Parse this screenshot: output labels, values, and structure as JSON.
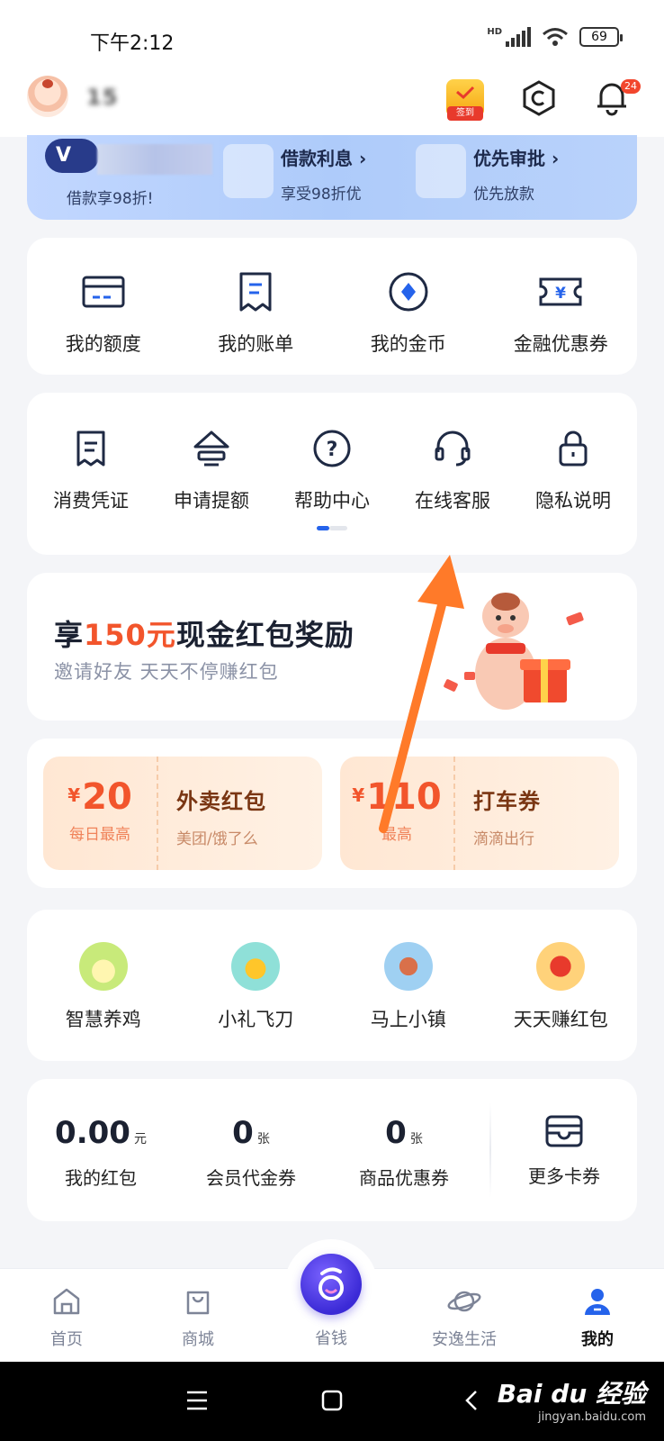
{
  "status_bar": {
    "time": "下午2:12",
    "battery": "69",
    "network_label": "HD"
  },
  "header": {
    "username": "15",
    "checkin_label": "签到",
    "notification_count": "24"
  },
  "banner": {
    "vip_letter": "V",
    "vip_subtitle": "借款享98折!",
    "benefits": [
      {
        "title": "借款利息 ›",
        "subtitle": "享受98折优"
      },
      {
        "title": "优先审批 ›",
        "subtitle": "优先放款"
      }
    ]
  },
  "quick_menu": [
    {
      "label": "我的额度",
      "icon": "credit-card-icon"
    },
    {
      "label": "我的账单",
      "icon": "bill-icon"
    },
    {
      "label": "我的金币",
      "icon": "coin-icon"
    },
    {
      "label": "金融优惠券",
      "icon": "yuan-ticket-icon"
    }
  ],
  "service_menu": [
    {
      "label": "消费凭证",
      "icon": "receipt-icon"
    },
    {
      "label": "申请提额",
      "icon": "raise-limit-icon"
    },
    {
      "label": "帮助中心",
      "icon": "help-icon"
    },
    {
      "label": "在线客服",
      "icon": "headset-icon"
    },
    {
      "label": "隐私说明",
      "icon": "lock-icon"
    }
  ],
  "promo": {
    "title_pre": "享",
    "title_amount": "150元",
    "title_post": "现金红包奖励",
    "subtitle": "邀请好友 天天不停赚红包"
  },
  "coupons": [
    {
      "currency": "¥",
      "amount": "20",
      "caption": "每日最高",
      "name": "外卖红包",
      "desc": "美团/饿了么"
    },
    {
      "currency": "¥",
      "amount": "110",
      "caption": "最高",
      "name": "打车券",
      "desc": "滴滴出行"
    }
  ],
  "games": [
    {
      "label": "智慧养鸡",
      "icon": "chick-icon",
      "color": "#c8ea7a"
    },
    {
      "label": "小礼飞刀",
      "icon": "knife-icon",
      "color": "#8fe0d8"
    },
    {
      "label": "马上小镇",
      "icon": "windmill-icon",
      "color": "#9fd0f2"
    },
    {
      "label": "天天赚红包",
      "icon": "red-packet-icon",
      "color": "#ffd27a"
    }
  ],
  "wallet": [
    {
      "value": "0.00",
      "unit": "元",
      "label": "我的红包"
    },
    {
      "value": "0",
      "unit": "张",
      "label": "会员代金券"
    },
    {
      "value": "0",
      "unit": "张",
      "label": "商品优惠券"
    }
  ],
  "more_cards": {
    "label": "更多卡券",
    "icon": "card-wallet-icon"
  },
  "tabbar": {
    "tabs": [
      {
        "label": "首页",
        "icon": "home-icon"
      },
      {
        "label": "商城",
        "icon": "shopping-bag-icon"
      },
      {
        "label": "省钱",
        "icon": "save-money-icon"
      },
      {
        "label": "安逸生活",
        "icon": "planet-icon"
      },
      {
        "label": "我的",
        "icon": "profile-icon"
      }
    ],
    "active": "我的"
  },
  "watermark": {
    "brand": "Bai du 经验",
    "url": "jingyan.baidu.com"
  },
  "colors": {
    "accent": "#f2552c",
    "primary": "#2563eb",
    "banner": "#aecbfa"
  }
}
